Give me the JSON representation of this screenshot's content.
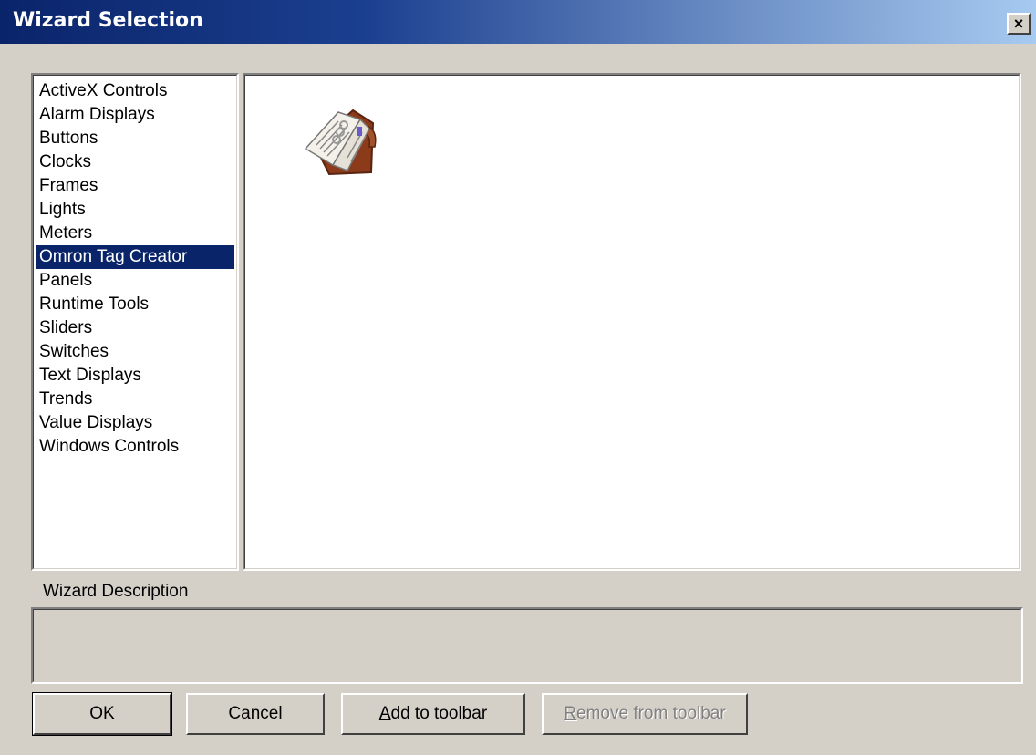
{
  "window": {
    "title": "Wizard Selection",
    "close_label": "×",
    "title_gradient": [
      "#0a246a",
      "#a6caf0"
    ]
  },
  "categories": {
    "items": [
      "ActiveX Controls",
      "Alarm Displays",
      "Buttons",
      "Clocks",
      "Frames",
      "Lights",
      "Meters",
      "Omron Tag Creator",
      "Panels",
      "Runtime Tools",
      "Sliders",
      "Switches",
      "Text Displays",
      "Trends",
      "Value Displays",
      "Windows Controls"
    ],
    "selected": "Omron Tag Creator",
    "selection_color": "#0a246a"
  },
  "preview": {
    "items": [
      {
        "icon": "organizer-book-icon"
      }
    ]
  },
  "description": {
    "label": "Wizard Description",
    "text": ""
  },
  "buttons": {
    "ok": "OK",
    "cancel": "Cancel",
    "add_to_toolbar": {
      "mnemonic": "A",
      "rest": "dd to toolbar"
    },
    "remove_from_toolbar": {
      "mnemonic": "R",
      "rest": "emove from toolbar",
      "enabled": false
    }
  }
}
